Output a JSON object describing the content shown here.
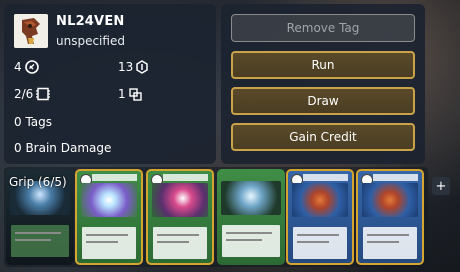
{
  "player": {
    "name": "NL24VEN",
    "subtitle": "unspecified"
  },
  "stats": {
    "credits": "4",
    "link": "13",
    "memory": "2/6",
    "agenda": "1",
    "tags": "0 Tags",
    "brain_damage": "0 Brain Damage"
  },
  "actions": {
    "remove_tag": "Remove Tag",
    "run": "Run",
    "draw": "Draw",
    "gain_credit": "Gain Credit"
  },
  "grip": {
    "label": "Grip (6/5)",
    "add_label": "+"
  },
  "colors": {
    "panel": "#1c2430",
    "button_border": "#c9a24a",
    "card_highlight": "#d4a530"
  }
}
